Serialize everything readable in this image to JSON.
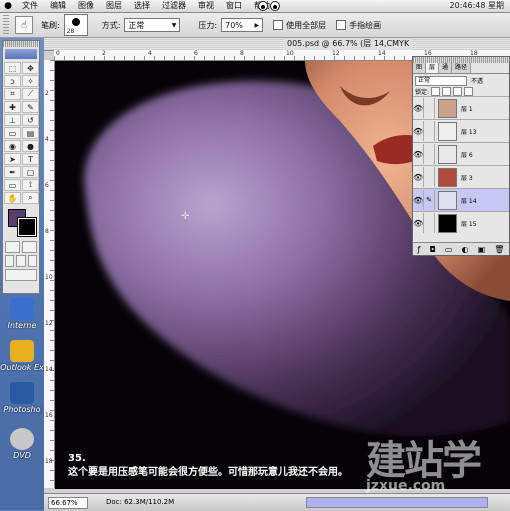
{
  "menubar": {
    "items": [
      "文件",
      "编辑",
      "图像",
      "图层",
      "选择",
      "过滤器",
      "审视",
      "窗口",
      "帮助"
    ],
    "clock": "20:46:48 星期"
  },
  "options": {
    "brush_label": "笔刷:",
    "brush_size": "28",
    "mode_label": "方式:",
    "mode_value": "正常",
    "pressure_label": "压力:",
    "pressure_value": "70%",
    "use_all_layers": "使用全部层",
    "finger_paint": "手指绘画"
  },
  "desktop_icons": [
    {
      "label": "Interne",
      "color": "#3a6fd0"
    },
    {
      "label": "Outlook Ex",
      "color": "#e8b020"
    },
    {
      "label": "Photosho",
      "color": "#2a5aa0"
    },
    {
      "label": "DVD",
      "color": "#c8c8c8"
    }
  ],
  "document": {
    "title": "005.psd @ 66.7% (层 14,CMYK",
    "ruler_top": [
      "0",
      "2",
      "4",
      "6",
      "8",
      "10",
      "12",
      "14",
      "16",
      "18"
    ],
    "ruler_left": [
      "2",
      "4",
      "6",
      "8",
      "10",
      "12",
      "14",
      "16",
      "18"
    ],
    "zoom": "66.67%",
    "doc_size": "Doc: 62.3M/110.2M"
  },
  "caption": {
    "line1": "35.",
    "line2": "这个要是用压感笔可能会很方便些。可惜那玩意儿我还不会用。"
  },
  "watermark": {
    "big": "建站学",
    "small": "jzxue.com"
  },
  "layers": {
    "tabs": [
      "图",
      "层",
      "通",
      "路径"
    ],
    "blend_mode": "正常",
    "opacity_label": "不透",
    "lock_label": "锁定:",
    "items": [
      {
        "name": "层 1",
        "active": false,
        "thumb": "#c9a38c"
      },
      {
        "name": "层 13",
        "active": false,
        "thumb": "#eeeeee"
      },
      {
        "name": "层 6",
        "active": false,
        "thumb": "#e9e9e9"
      },
      {
        "name": "层 3",
        "active": false,
        "thumb": "#b04a3a"
      },
      {
        "name": "层 14",
        "active": true,
        "thumb": "#e0e0f0"
      },
      {
        "name": "层 15",
        "active": false,
        "thumb": "#000000"
      }
    ]
  },
  "colors": {
    "foreground": "#5a3e6e",
    "background": "#000000",
    "accent": "#c7c7f3"
  }
}
